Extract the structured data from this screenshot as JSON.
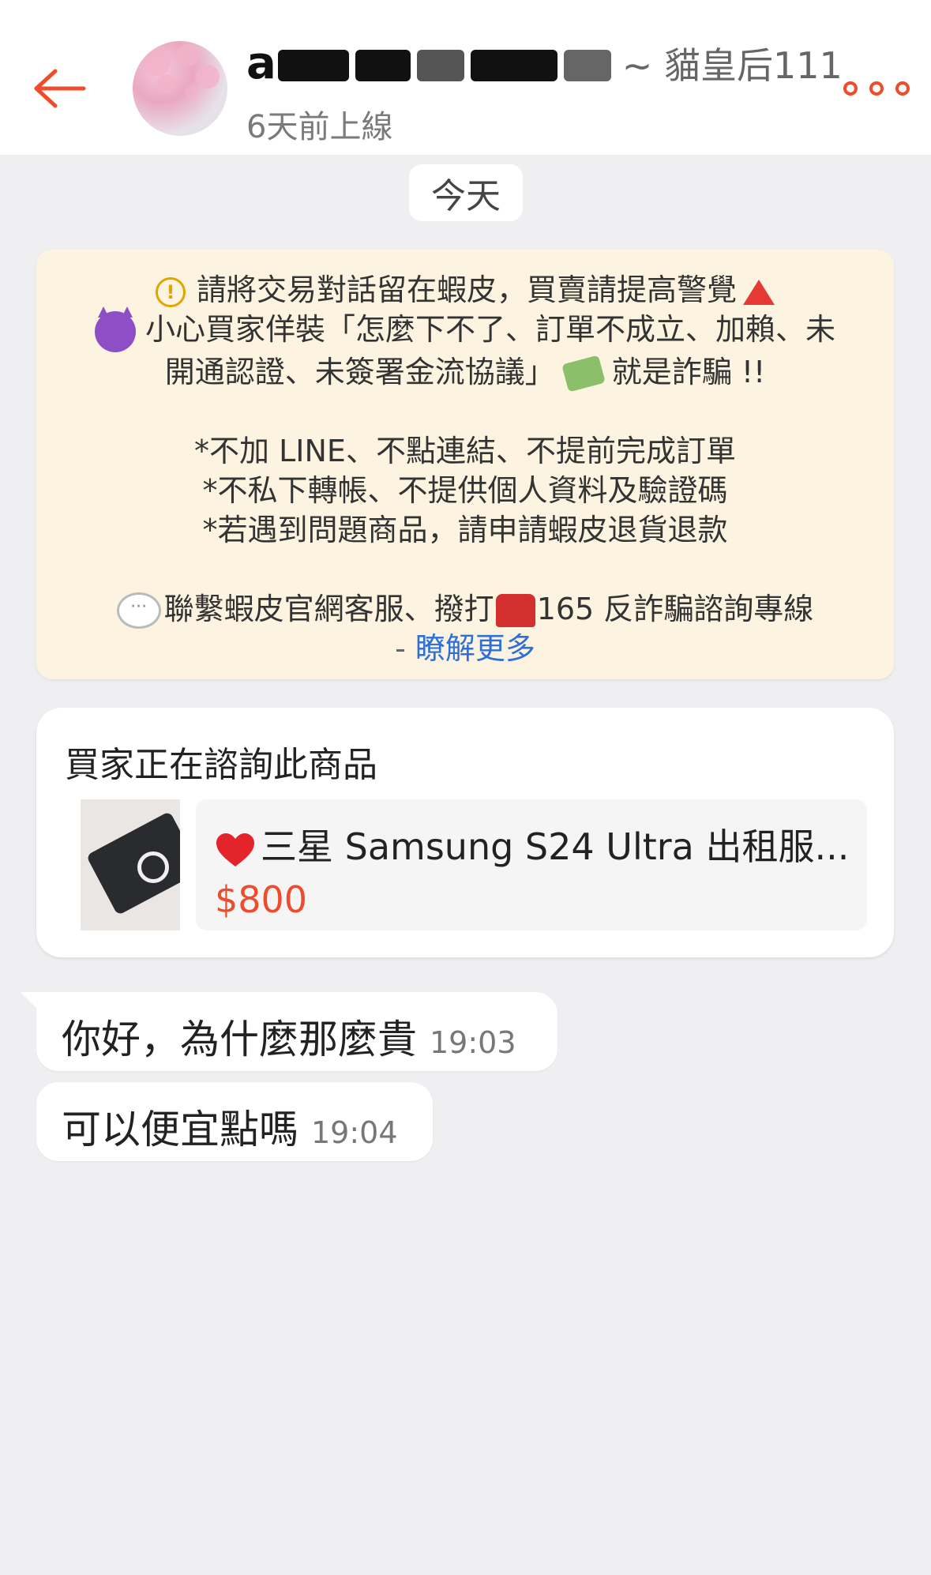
{
  "header": {
    "title_visible_prefix": "a",
    "shop_name": "~ 貓皇后111",
    "last_seen": "6天前上線"
  },
  "date_divider": "今天",
  "notice": {
    "line1": "請將交易對話留在蝦皮，買賣請提高警覺",
    "line2": "小心買家佯裝「怎麼下不了、訂單不成立、加賴、未",
    "line3_a": "開通認證、未簽署金流協議」",
    "line3_b": "就是詐騙 !!",
    "line4": "*不加 LINE、不點連結、不提前完成訂單",
    "line5": "*不私下轉帳、不提供個人資料及驗證碼",
    "line6": "*若遇到問題商品，請申請蝦皮退貨退款",
    "line7_a": "聯繫蝦皮官網客服、撥打",
    "line7_b": "165 反詐騙諮詢專線",
    "line8_dash": "-",
    "learn_more": "瞭解更多",
    "colors": {
      "warning": "#e0a500",
      "alert": "#e53935",
      "link": "#2f6fd6",
      "background": "#fcf4e1"
    }
  },
  "inquiry": {
    "title": "買家正在諮詢此商品",
    "product_name": "三星 Samsung S24 Ultra 出租服...",
    "product_price": "$800"
  },
  "messages": [
    {
      "text": "你好，為什麼那麼貴",
      "time": "19:03"
    },
    {
      "text": "可以便宜點嗎",
      "time": "19:04"
    }
  ],
  "colors": {
    "accent": "#ee4d2d",
    "background": "#efeff1"
  },
  "icons": {
    "back": "arrow-left-icon",
    "more": "more-options-icon",
    "warning": "warning-circle-icon",
    "triangle": "red-triangle-icon",
    "devil": "smiling-devil-icon",
    "money": "money-with-wings-icon",
    "chat": "speech-bubble-icon",
    "phone": "telephone-icon",
    "heart": "heart-icon"
  }
}
